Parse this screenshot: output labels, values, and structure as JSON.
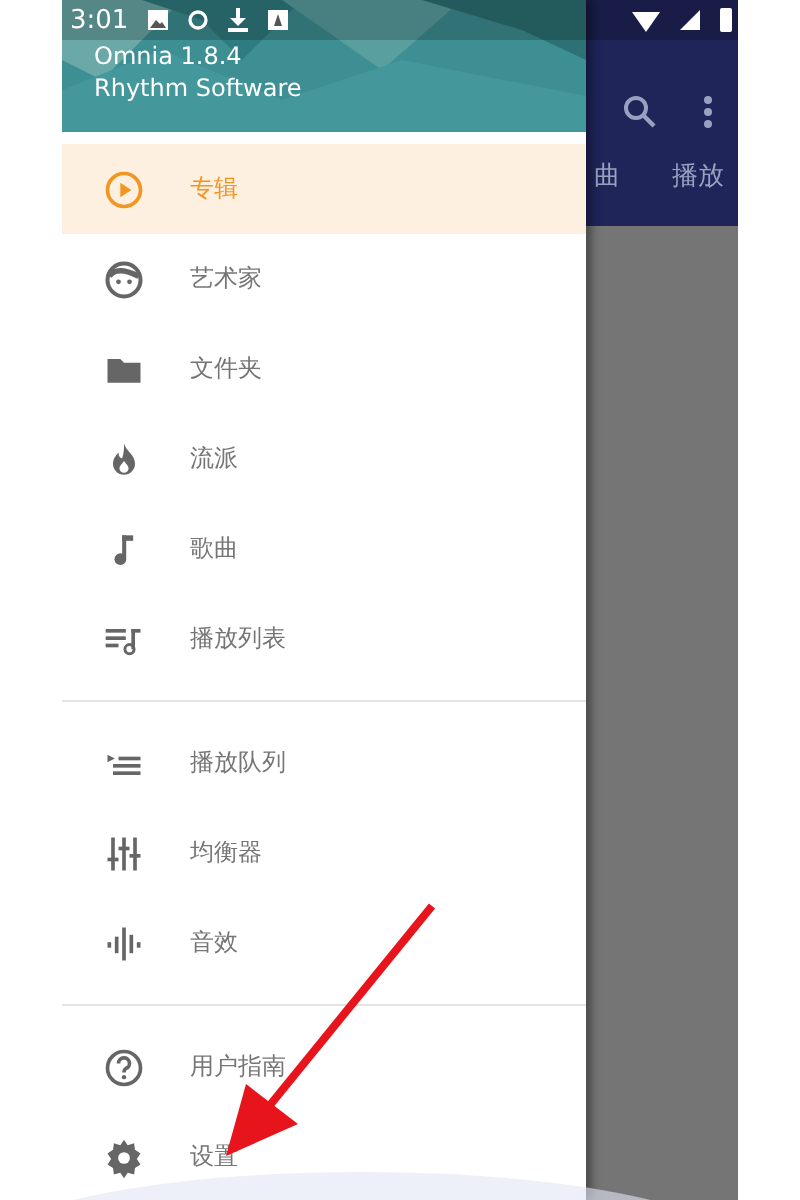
{
  "status_bar": {
    "time": "3:01"
  },
  "drawer": {
    "header": {
      "kind": "picture",
      "title": "Omnia 1.8.4",
      "subtitle": "Rhythm Software"
    },
    "sections": [
      {
        "items": [
          {
            "kind": "album",
            "label": "专辑",
            "selected": true
          },
          {
            "kind": "artist",
            "label": "艺术家",
            "selected": false
          },
          {
            "kind": "folder",
            "label": "文件夹",
            "selected": false
          },
          {
            "kind": "genre",
            "label": "流派",
            "selected": false
          },
          {
            "kind": "song",
            "label": "歌曲",
            "selected": false
          },
          {
            "kind": "playlist",
            "label": "播放列表",
            "selected": false
          }
        ]
      },
      {
        "items": [
          {
            "kind": "queue",
            "label": "播放队列",
            "selected": false
          },
          {
            "kind": "equalizer",
            "label": "均衡器",
            "selected": false
          },
          {
            "kind": "effects",
            "label": "音效",
            "selected": false
          }
        ]
      },
      {
        "items": [
          {
            "kind": "help",
            "label": "用户指南",
            "selected": false
          },
          {
            "kind": "settings",
            "label": "设置",
            "selected": false
          }
        ]
      }
    ]
  },
  "app_tabs": [
    "曲",
    "播放"
  ]
}
